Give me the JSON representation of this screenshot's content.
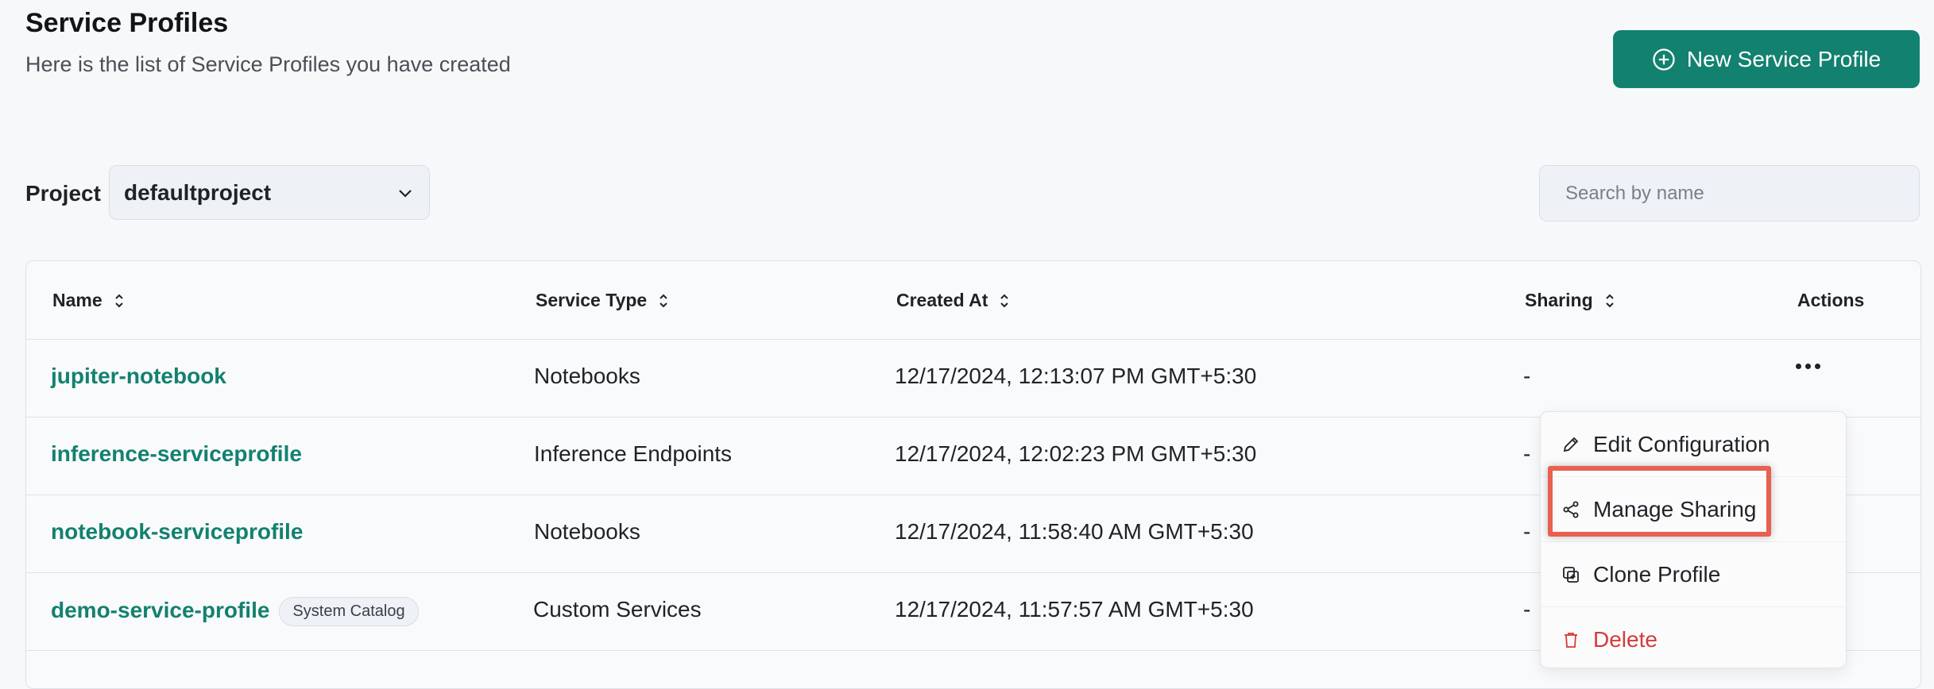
{
  "header": {
    "title": "Service Profiles",
    "subtitle": "Here is the list of Service Profiles you have created",
    "new_button_label": "New Service Profile"
  },
  "filters": {
    "project_label": "Project",
    "project_value": "defaultproject",
    "search_placeholder": "Search by name"
  },
  "table": {
    "columns": [
      "Name",
      "Service Type",
      "Created At",
      "Sharing",
      "Actions"
    ],
    "rows": [
      {
        "name": "jupiter-notebook",
        "badge": "",
        "service_type": "Notebooks",
        "created_at": "12/17/2024, 12:13:07 PM GMT+5:30",
        "sharing": "-"
      },
      {
        "name": "inference-serviceprofile",
        "badge": "",
        "service_type": "Inference Endpoints",
        "created_at": "12/17/2024, 12:02:23 PM GMT+5:30",
        "sharing": "-"
      },
      {
        "name": "notebook-serviceprofile",
        "badge": "",
        "service_type": "Notebooks",
        "created_at": "12/17/2024, 11:58:40 AM GMT+5:30",
        "sharing": "-"
      },
      {
        "name": "demo-service-profile",
        "badge": "System Catalog",
        "service_type": "Custom Services",
        "created_at": "12/17/2024, 11:57:57 AM GMT+5:30",
        "sharing": "-"
      }
    ]
  },
  "actions_menu": {
    "items": [
      {
        "label": "Edit Configuration",
        "icon": "pencil-icon"
      },
      {
        "label": "Manage Sharing",
        "icon": "share-icon",
        "highlighted": true
      },
      {
        "label": "Clone Profile",
        "icon": "clone-icon"
      },
      {
        "label": "Delete",
        "icon": "trash-icon",
        "danger": true
      }
    ]
  },
  "colors": {
    "brand": "#13816f",
    "danger": "#d43b3b",
    "highlight": "#e8604f"
  }
}
